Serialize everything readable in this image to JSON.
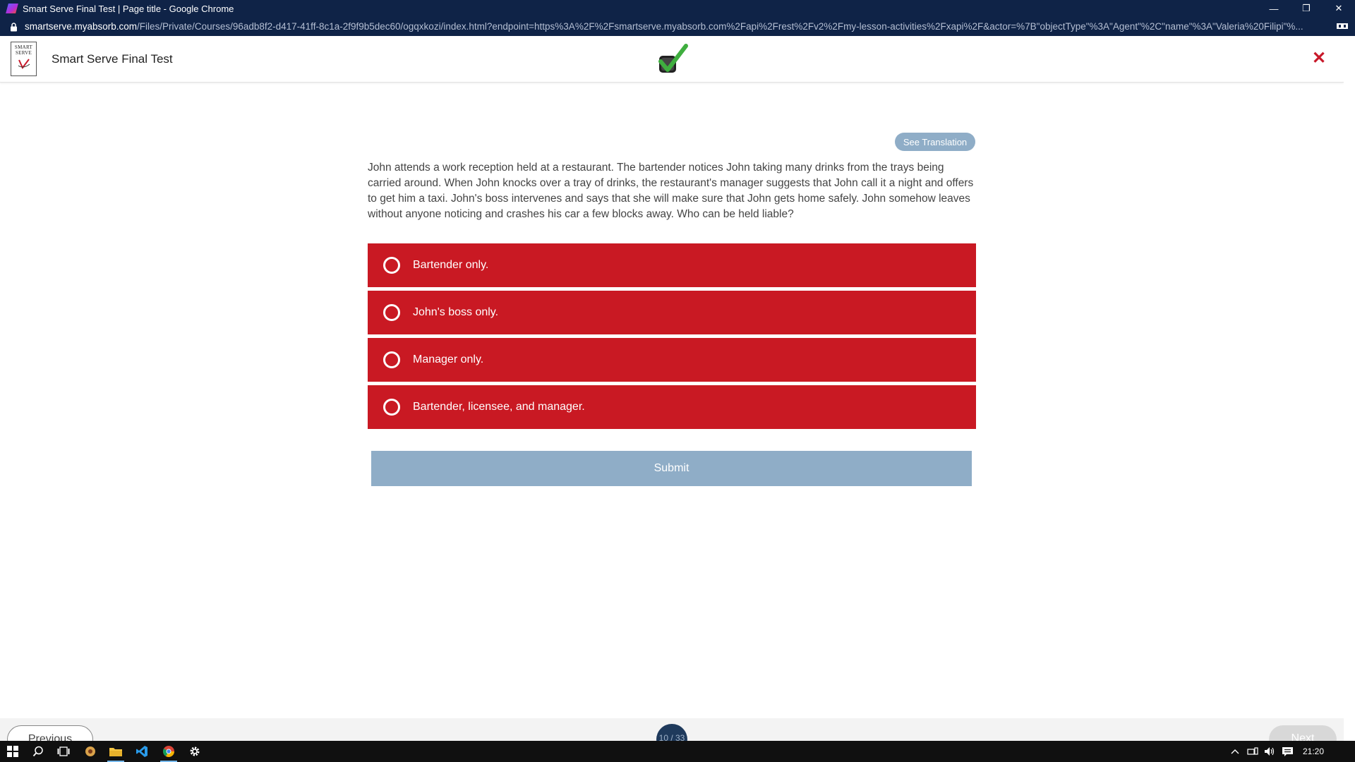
{
  "window": {
    "title": "Smart Serve Final Test | Page title - Google Chrome",
    "min_glyph": "—",
    "max_glyph": "❐",
    "close_glyph": "✕"
  },
  "address": {
    "host": "smartserve.myabsorb.com",
    "path": "/Files/Private/Courses/96adb8f2-d417-41ff-8c1a-2f9f9b5dec60/ogqxkozi/index.html?endpoint=https%3A%2F%2Fsmartserve.myabsorb.com%2Fapi%2Frest%2Fv2%2Fmy-lesson-activities%2Fxapi%2F&actor=%7B\"objectType\"%3A\"Agent\"%2C\"name\"%3A\"Valeria%20Filipi\"%..."
  },
  "header": {
    "logo_line1": "SMART",
    "logo_line2": "SERVE",
    "app_title": "Smart Serve Final Test",
    "close_glyph": "✕"
  },
  "content": {
    "see_translation": "See Translation",
    "question": "John attends a work reception held at a restaurant. The bartender notices John taking many drinks from the trays being carried around. When John knocks over a tray of drinks, the restaurant's manager suggests that John call it a night and offers to get him a taxi. John's boss intervenes and says that she will make sure that John gets home safely. John somehow leaves without anyone noticing and crashes his car a few blocks away. Who can be held liable?",
    "options": [
      {
        "label": "Bartender only."
      },
      {
        "label": "John's boss only."
      },
      {
        "label": "Manager only."
      },
      {
        "label": "Bartender, licensee, and manager."
      }
    ],
    "submit": "Submit"
  },
  "nav": {
    "previous": "Previous",
    "progress": "10 / 33",
    "next": "Next"
  },
  "taskbar": {
    "time": "21:20"
  },
  "colors": {
    "option_red": "#c91923",
    "submit_blue": "#8fadc7",
    "chrome_navy": "#0f2347"
  }
}
